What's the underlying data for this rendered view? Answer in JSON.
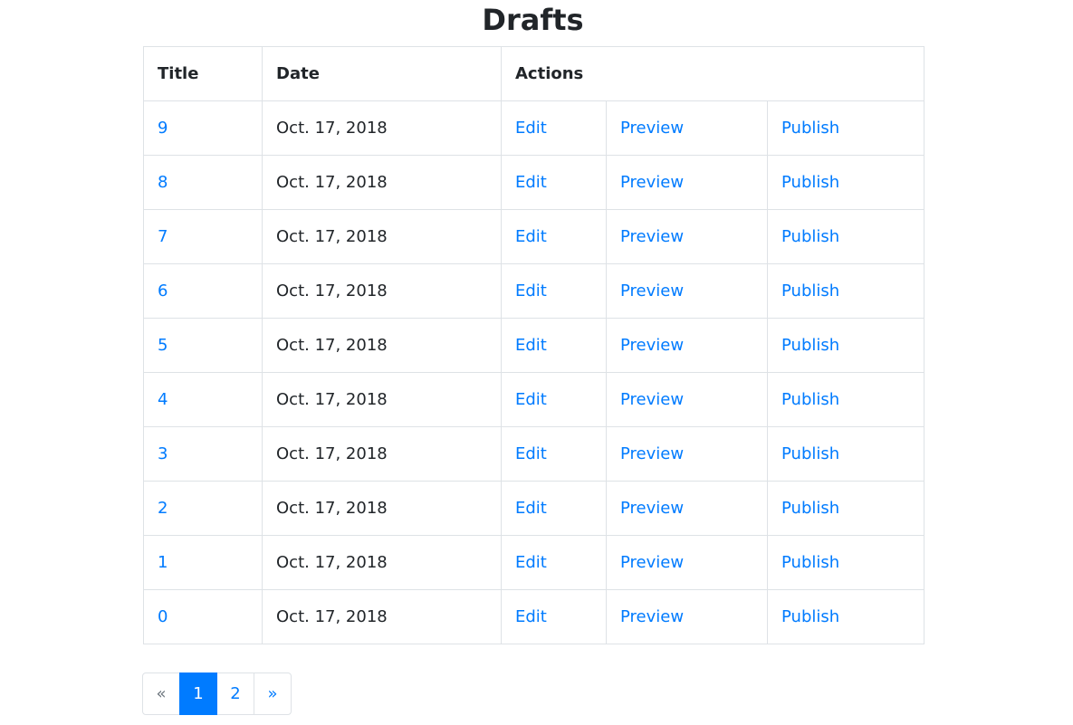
{
  "page": {
    "title": "Drafts"
  },
  "table": {
    "headers": {
      "title": "Title",
      "date": "Date",
      "actions": "Actions"
    },
    "rows": [
      {
        "title": "9",
        "date": "Oct. 17, 2018",
        "edit": "Edit",
        "preview": "Preview",
        "publish": "Publish"
      },
      {
        "title": "8",
        "date": "Oct. 17, 2018",
        "edit": "Edit",
        "preview": "Preview",
        "publish": "Publish"
      },
      {
        "title": "7",
        "date": "Oct. 17, 2018",
        "edit": "Edit",
        "preview": "Preview",
        "publish": "Publish"
      },
      {
        "title": "6",
        "date": "Oct. 17, 2018",
        "edit": "Edit",
        "preview": "Preview",
        "publish": "Publish"
      },
      {
        "title": "5",
        "date": "Oct. 17, 2018",
        "edit": "Edit",
        "preview": "Preview",
        "publish": "Publish"
      },
      {
        "title": "4",
        "date": "Oct. 17, 2018",
        "edit": "Edit",
        "preview": "Preview",
        "publish": "Publish"
      },
      {
        "title": "3",
        "date": "Oct. 17, 2018",
        "edit": "Edit",
        "preview": "Preview",
        "publish": "Publish"
      },
      {
        "title": "2",
        "date": "Oct. 17, 2018",
        "edit": "Edit",
        "preview": "Preview",
        "publish": "Publish"
      },
      {
        "title": "1",
        "date": "Oct. 17, 2018",
        "edit": "Edit",
        "preview": "Preview",
        "publish": "Publish"
      },
      {
        "title": "0",
        "date": "Oct. 17, 2018",
        "edit": "Edit",
        "preview": "Preview",
        "publish": "Publish"
      }
    ]
  },
  "pagination": {
    "prev_label": "«",
    "pages": [
      "1",
      "2"
    ],
    "active_page": "1",
    "next_label": "»"
  },
  "colors": {
    "link": "#007bff",
    "text": "#212529",
    "border": "#dee2e6",
    "active_page_bg": "#007bff"
  }
}
